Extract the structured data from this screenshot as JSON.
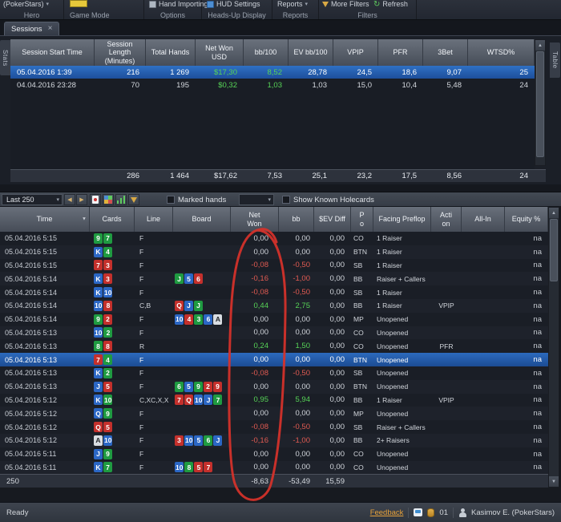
{
  "icons": {
    "dropdown_arrow": "▾",
    "close": "×",
    "scroll_up": "▲",
    "scroll_down": "▼",
    "filter_arrow": "▼",
    "prev_arrow": "◀",
    "next_arrow": "▶",
    "refresh_glyph": "↻"
  },
  "ribbon": {
    "hero_button": "(PokerStars)",
    "hero_caption": "Hero",
    "game_mode_caption": "Game Mode",
    "hand_importing_button": "Hand Importing",
    "options_caption": "Options",
    "hud_settings_button": "HUD Settings",
    "hud_caption": "Heads-Up Display",
    "reports_button": "Reports",
    "reports_caption": "Reports",
    "more_filters_button": "More Filters",
    "refresh_button": "Refresh",
    "filters_caption": "Filters"
  },
  "tabs": {
    "sessions_label": "Sessions"
  },
  "side_tabs": {
    "stats": "Stats",
    "table": "Table"
  },
  "sessions_table": {
    "columns": [
      "Session Start Time",
      "Session Length (Minutes)",
      "Total Hands",
      "Net Won USD",
      "bb/100",
      "EV bb/100",
      "VPIP",
      "PFR",
      "3Bet",
      "WTSD%"
    ],
    "rows": [
      {
        "selected": true,
        "cells": [
          "05.04.2016 1:39",
          "216",
          "1 269",
          "$17,30",
          "8,52",
          "28,78",
          "24,5",
          "18,6",
          "9,07",
          "25"
        ]
      },
      {
        "selected": false,
        "cells": [
          "04.04.2016 23:28",
          "70",
          "195",
          "$0,32",
          "1,03",
          "1,03",
          "15,0",
          "10,4",
          "5,48",
          "24"
        ]
      }
    ],
    "summary": [
      "",
      "286",
      "1 464",
      "$17,62",
      "7,53",
      "25,1",
      "23,2",
      "17,5",
      "8,56",
      "24"
    ]
  },
  "hands_toolbar": {
    "range_select_value": "Last 250",
    "marked_hands_label": "Marked hands",
    "show_known_holecards_label": "Show Known Holecards"
  },
  "hands_table": {
    "columns": [
      "Time",
      "Cards",
      "Line",
      "Board",
      "Net Won",
      "bb",
      "$EV Diff",
      "Po",
      "Facing Preflop",
      "Action",
      "All-In",
      "Equity %"
    ],
    "rows": [
      {
        "time": "05.04.2016 5:15",
        "cards": [
          [
            "9",
            "c"
          ],
          [
            "7",
            "c"
          ]
        ],
        "line": "F",
        "board": [],
        "net": "0,00",
        "bb": "0,00",
        "ev": "0,00",
        "pos": "CO",
        "facing": "1 Raiser",
        "action": "",
        "all_in": "",
        "equity": "na",
        "selected": false
      },
      {
        "time": "05.04.2016 5:15",
        "cards": [
          [
            "K",
            "d"
          ],
          [
            "4",
            "c"
          ]
        ],
        "line": "F",
        "board": [],
        "net": "0,00",
        "bb": "0,00",
        "ev": "0,00",
        "pos": "BTN",
        "facing": "1 Raiser",
        "action": "",
        "all_in": "",
        "equity": "na",
        "selected": false
      },
      {
        "time": "05.04.2016 5:15",
        "cards": [
          [
            "7",
            "h"
          ],
          [
            "3",
            "h"
          ]
        ],
        "line": "F",
        "board": [],
        "net": "-0,08",
        "bb": "-0,50",
        "ev": "0,00",
        "pos": "SB",
        "facing": "1 Raiser",
        "action": "",
        "all_in": "",
        "equity": "na",
        "selected": false
      },
      {
        "time": "05.04.2016 5:14",
        "cards": [
          [
            "K",
            "d"
          ],
          [
            "3",
            "h"
          ]
        ],
        "line": "F",
        "board": [
          [
            "J",
            "c"
          ],
          [
            "5",
            "d"
          ],
          [
            "6",
            "h"
          ]
        ],
        "net": "-0,16",
        "bb": "-1,00",
        "ev": "0,00",
        "pos": "BB",
        "facing": "Raiser + Callers",
        "action": "",
        "all_in": "",
        "equity": "na",
        "selected": false
      },
      {
        "time": "05.04.2016 5:14",
        "cards": [
          [
            "K",
            "d"
          ],
          [
            "10",
            "d"
          ]
        ],
        "line": "F",
        "board": [],
        "net": "-0,08",
        "bb": "-0,50",
        "ev": "0,00",
        "pos": "SB",
        "facing": "1 Raiser",
        "action": "",
        "all_in": "",
        "equity": "na",
        "selected": false
      },
      {
        "time": "05.04.2016 5:14",
        "cards": [
          [
            "10",
            "d"
          ],
          [
            "8",
            "h"
          ]
        ],
        "line": "C,B",
        "board": [
          [
            "Q",
            "h"
          ],
          [
            "J",
            "d"
          ],
          [
            "J",
            "c"
          ]
        ],
        "net": "0,44",
        "bb": "2,75",
        "ev": "0,00",
        "pos": "BB",
        "facing": "1 Raiser",
        "action": "VPIP",
        "all_in": "",
        "equity": "na",
        "selected": false
      },
      {
        "time": "05.04.2016 5:14",
        "cards": [
          [
            "9",
            "c"
          ],
          [
            "2",
            "h"
          ]
        ],
        "line": "F",
        "board": [
          [
            "10",
            "d"
          ],
          [
            "4",
            "h"
          ],
          [
            "3",
            "c"
          ],
          [
            "6",
            "d"
          ],
          [
            "A",
            "s"
          ]
        ],
        "net": "0,00",
        "bb": "0,00",
        "ev": "0,00",
        "pos": "MP",
        "facing": "Unopened",
        "action": "",
        "all_in": "",
        "equity": "na",
        "selected": false
      },
      {
        "time": "05.04.2016 5:13",
        "cards": [
          [
            "10",
            "d"
          ],
          [
            "2",
            "c"
          ]
        ],
        "line": "F",
        "board": [],
        "net": "0,00",
        "bb": "0,00",
        "ev": "0,00",
        "pos": "CO",
        "facing": "Unopened",
        "action": "",
        "all_in": "",
        "equity": "na",
        "selected": false
      },
      {
        "time": "05.04.2016 5:13",
        "cards": [
          [
            "8",
            "c"
          ],
          [
            "8",
            "h"
          ]
        ],
        "line": "R",
        "board": [],
        "net": "0,24",
        "bb": "1,50",
        "ev": "0,00",
        "pos": "CO",
        "facing": "Unopened",
        "action": "PFR",
        "all_in": "",
        "equity": "na",
        "selected": false
      },
      {
        "time": "05.04.2016 5:13",
        "cards": [
          [
            "7",
            "h"
          ],
          [
            "4",
            "c"
          ]
        ],
        "line": "F",
        "board": [],
        "net": "0,00",
        "bb": "0,00",
        "ev": "0,00",
        "pos": "BTN",
        "facing": "Unopened",
        "action": "",
        "all_in": "",
        "equity": "na",
        "selected": true
      },
      {
        "time": "05.04.2016 5:13",
        "cards": [
          [
            "K",
            "d"
          ],
          [
            "2",
            "c"
          ]
        ],
        "line": "F",
        "board": [],
        "net": "-0,08",
        "bb": "-0,50",
        "ev": "0,00",
        "pos": "SB",
        "facing": "Unopened",
        "action": "",
        "all_in": "",
        "equity": "na",
        "selected": false
      },
      {
        "time": "05.04.2016 5:13",
        "cards": [
          [
            "J",
            "d"
          ],
          [
            "5",
            "h"
          ]
        ],
        "line": "F",
        "board": [
          [
            "6",
            "c"
          ],
          [
            "5",
            "d"
          ],
          [
            "9",
            "c"
          ],
          [
            "2",
            "h"
          ],
          [
            "9",
            "h"
          ]
        ],
        "net": "0,00",
        "bb": "0,00",
        "ev": "0,00",
        "pos": "BTN",
        "facing": "Unopened",
        "action": "",
        "all_in": "",
        "equity": "na",
        "selected": false
      },
      {
        "time": "05.04.2016 5:12",
        "cards": [
          [
            "K",
            "d"
          ],
          [
            "10",
            "c"
          ]
        ],
        "line": "C,XC,X,X",
        "board": [
          [
            "7",
            "h"
          ],
          [
            "Q",
            "h"
          ],
          [
            "10",
            "d"
          ],
          [
            "J",
            "d"
          ],
          [
            "7",
            "c"
          ]
        ],
        "net": "0,95",
        "bb": "5,94",
        "ev": "0,00",
        "pos": "BB",
        "facing": "1 Raiser",
        "action": "VPIP",
        "all_in": "",
        "equity": "na",
        "selected": false
      },
      {
        "time": "05.04.2016 5:12",
        "cards": [
          [
            "Q",
            "d"
          ],
          [
            "9",
            "c"
          ]
        ],
        "line": "F",
        "board": [],
        "net": "0,00",
        "bb": "0,00",
        "ev": "0,00",
        "pos": "MP",
        "facing": "Unopened",
        "action": "",
        "all_in": "",
        "equity": "na",
        "selected": false
      },
      {
        "time": "05.04.2016 5:12",
        "cards": [
          [
            "Q",
            "h"
          ],
          [
            "5",
            "h"
          ]
        ],
        "line": "F",
        "board": [],
        "net": "-0,08",
        "bb": "-0,50",
        "ev": "0,00",
        "pos": "SB",
        "facing": "Raiser + Callers",
        "action": "",
        "all_in": "",
        "equity": "na",
        "selected": false
      },
      {
        "time": "05.04.2016 5:12",
        "cards": [
          [
            "A",
            "s"
          ],
          [
            "10",
            "d"
          ]
        ],
        "line": "F",
        "board": [
          [
            "3",
            "h"
          ],
          [
            "10",
            "d"
          ],
          [
            "5",
            "d"
          ],
          [
            "6",
            "c"
          ],
          [
            "J",
            "d"
          ]
        ],
        "net": "-0,16",
        "bb": "-1,00",
        "ev": "0,00",
        "pos": "BB",
        "facing": "2+ Raisers",
        "action": "",
        "all_in": "",
        "equity": "na",
        "selected": false
      },
      {
        "time": "05.04.2016 5:11",
        "cards": [
          [
            "J",
            "d"
          ],
          [
            "9",
            "c"
          ]
        ],
        "line": "F",
        "board": [],
        "net": "0,00",
        "bb": "0,00",
        "ev": "0,00",
        "pos": "CO",
        "facing": "Unopened",
        "action": "",
        "all_in": "",
        "equity": "na",
        "selected": false
      },
      {
        "time": "05.04.2016 5:11",
        "cards": [
          [
            "K",
            "d"
          ],
          [
            "7",
            "c"
          ]
        ],
        "line": "F",
        "board": [
          [
            "10",
            "d"
          ],
          [
            "8",
            "c"
          ],
          [
            "5",
            "h"
          ],
          [
            "7",
            "h"
          ]
        ],
        "net": "0,00",
        "bb": "0,00",
        "ev": "0,00",
        "pos": "CO",
        "facing": "Unopened",
        "action": "",
        "all_in": "",
        "equity": "na",
        "selected": false
      }
    ],
    "summary": {
      "count": "250",
      "net_won": "-8,63",
      "bb": "-53,49",
      "ev_diff": "15,59"
    }
  },
  "status_bar": {
    "ready": "Ready",
    "feedback": "Feedback",
    "badge": "01",
    "user": "Kasimov E. (PokerStars)"
  },
  "annotation": {
    "shape": "hand-drawn-ellipse",
    "target": "net-won-column",
    "color": "#d8322a"
  }
}
